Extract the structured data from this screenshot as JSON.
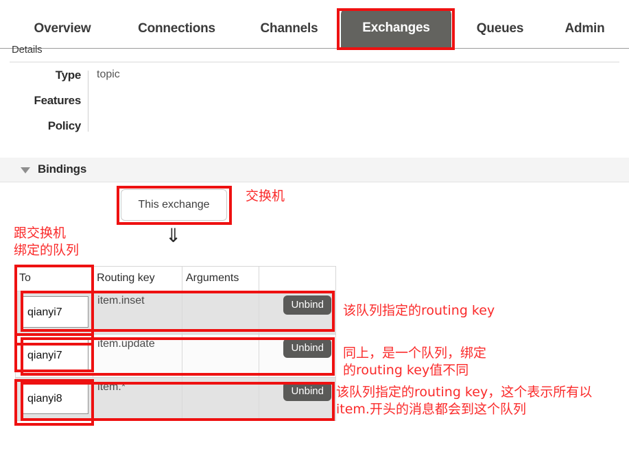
{
  "nav": {
    "tabs": [
      {
        "label": "Overview",
        "active": false
      },
      {
        "label": "Connections",
        "active": false
      },
      {
        "label": "Channels",
        "active": false
      },
      {
        "label": "Exchanges",
        "active": true
      },
      {
        "label": "Queues",
        "active": false
      },
      {
        "label": "Admin",
        "active": false
      }
    ],
    "active_tab_color": "#63635f"
  },
  "details": {
    "section_label": "Details",
    "rows": [
      {
        "key": "Type",
        "value": "topic"
      },
      {
        "key": "Features",
        "value": ""
      },
      {
        "key": "Policy",
        "value": ""
      }
    ]
  },
  "bindings": {
    "section_title": "Bindings",
    "caret_icon": "triangle-down-icon",
    "this_exchange_button": "This exchange",
    "arrow_icon": "double-down-arrow-icon",
    "table": {
      "headers": [
        "To",
        "Routing key",
        "Arguments",
        ""
      ],
      "rows": [
        {
          "to": "qianyi7",
          "routing_key": "item.inset",
          "arguments": "",
          "action": "Unbind"
        },
        {
          "to": "qianyi7",
          "routing_key": "item.update",
          "arguments": "",
          "action": "Unbind"
        },
        {
          "to": "qianyi8",
          "routing_key": "item.*",
          "arguments": "",
          "action": "Unbind"
        }
      ]
    }
  },
  "annotations": {
    "color": "#fa2a2a",
    "queues_bound_label": "跟交换机\n绑定的队列",
    "exchange_label": "交换机",
    "row1_note": "该队列指定的routing key",
    "row2_note": "同上，是一个队列，绑定\n的routing key值不同",
    "row3_note": "该队列指定的routing key，这个表示所有以\nitem.开头的消息都会到这个队列"
  }
}
